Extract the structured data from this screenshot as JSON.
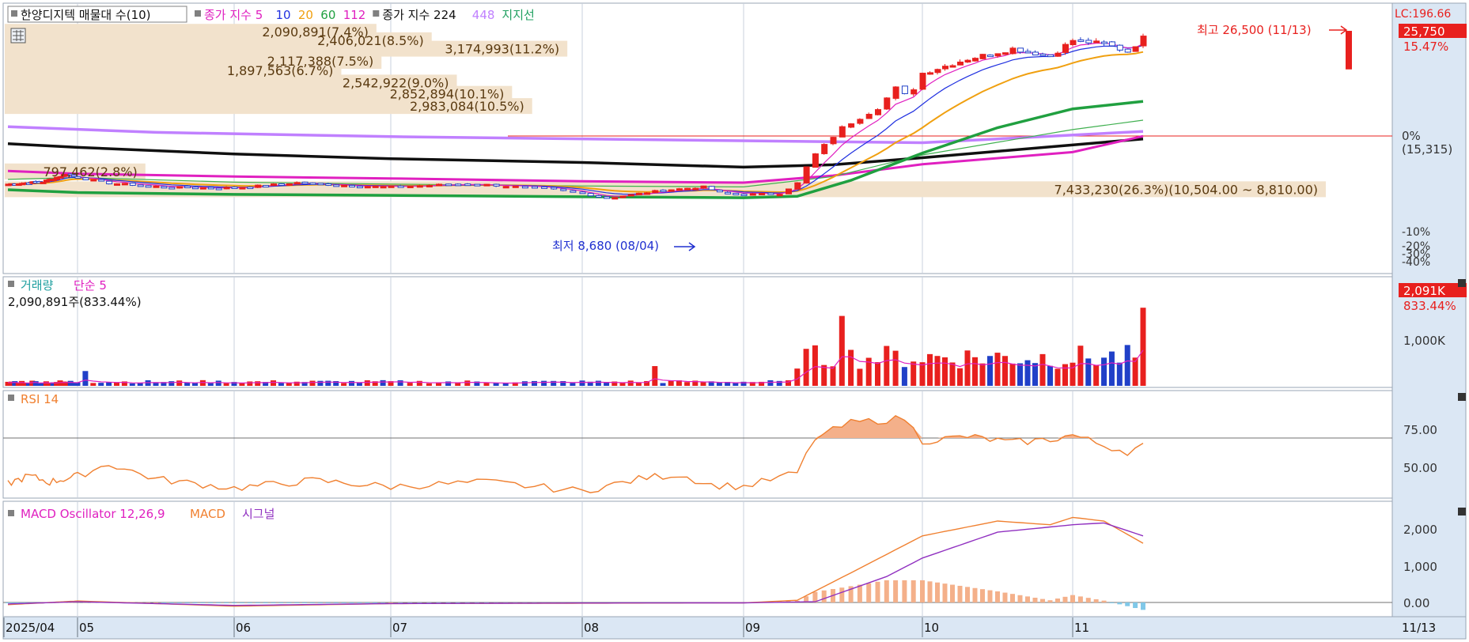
{
  "colors": {
    "up": "#e8201e",
    "down": "#2040c8",
    "ma5": "#e020c0",
    "ma10": "#2030e0",
    "ma20": "#f0a010",
    "ma60": "#20a040",
    "ma112": "#40a060",
    "ma224": "#101010",
    "ma448": "#c080ff",
    "support": "#20a060",
    "rsi": "#f08030",
    "rsi_fill": "#f4b08a",
    "macd_osc": "#e020c0",
    "macd": "#f08030",
    "signal": "#9030c0",
    "histo_pos": "#f4b08a",
    "histo_neg": "#80c8e8",
    "volume_profile": "#f2e2cc",
    "grid": "#c8d0dc",
    "axis_bg": "#dbe7f4"
  },
  "price_panel": {
    "title": "한양디지텍 매물대 수(10)",
    "legend": [
      {
        "label": "종가 지수 5",
        "color": "#e020c0"
      },
      {
        "label": "10",
        "color": "#2030e0"
      },
      {
        "label": "20",
        "color": "#f0a010"
      },
      {
        "label": "60",
        "color": "#20a040"
      },
      {
        "label": "112",
        "color": "#e020c0"
      },
      {
        "label": "종가 지수 224",
        "color": "#101010"
      },
      {
        "label": "448",
        "color": "#c080ff"
      },
      {
        "label": "지지선",
        "color": "#20a060"
      }
    ],
    "high_annotation": "최고 26,500 (11/13)",
    "low_annotation": "최저 8,680 (08/04)",
    "lc_label": "LC:196.66",
    "current_price_label": "25,750",
    "change_label": "15.47%",
    "pct_label": "0%",
    "pct_value_label": "(15,315)",
    "right_ticks": [
      "-10%",
      "-20%",
      "-30%",
      "-40%"
    ],
    "volume_profile": [
      {
        "label": "2,090,891(7.4%)",
        "price": 26400,
        "share": 7.4
      },
      {
        "label": "2,406,021(8.5%)",
        "price": 25500,
        "share": 8.5
      },
      {
        "label": "3,174,993(11.2%)",
        "price": 24600,
        "share": 11.2
      },
      {
        "label": "2,117,388(7.5%)",
        "price": 23300,
        "share": 7.5
      },
      {
        "label": "1,897,563(6.7%)",
        "price": 22300,
        "share": 6.7
      },
      {
        "label": "2,542,922(9.0%)",
        "price": 21000,
        "share": 9.0
      },
      {
        "label": "2,852,894(10.1%)",
        "price": 19800,
        "share": 10.1
      },
      {
        "label": "2,983,084(10.5%)",
        "price": 18500,
        "share": 10.5
      },
      {
        "label": "797,462(2.8%)",
        "price": 11550,
        "share": 2.8
      },
      {
        "label": "7,433,230(26.3%)(10,504.00 ~ 8,810.00)",
        "price": 9650,
        "share": 26.3
      }
    ]
  },
  "volume_panel": {
    "title": "거래량",
    "ma_label": "단순 5",
    "summary": "2,090,891주(833.44%)",
    "last_label": "2,091K",
    "last_pct": "833.44%",
    "ticks": [
      "1,000K"
    ]
  },
  "rsi_panel": {
    "title": "RSI 14",
    "ticks": [
      "75.00",
      "50.00"
    ]
  },
  "macd_panel": {
    "title_osc": "MACD Oscillator 12,26,9",
    "title_macd": "MACD",
    "title_signal": "시그널",
    "ticks": [
      "2,000",
      "1,000",
      "0.00"
    ]
  },
  "x_axis": {
    "labels": [
      "2025/04",
      "05",
      "06",
      "07",
      "08",
      "09",
      "10",
      "11"
    ],
    "right_label": "11/13"
  },
  "chart_data": [
    {
      "type": "candlestick",
      "title": "한양디지텍",
      "x_range": [
        "2025/04",
        "11/13"
      ],
      "y_range": [
        8000,
        27000
      ],
      "key_points": [
        {
          "date": "2025/04",
          "close": 10200
        },
        {
          "date": "05",
          "close": 10900
        },
        {
          "date": "06",
          "close": 9800
        },
        {
          "date": "07",
          "close": 9900
        },
        {
          "date": "08/04",
          "close": 8680
        },
        {
          "date": "09",
          "close": 9100
        },
        {
          "date": "10",
          "close": 22000
        },
        {
          "date": "11",
          "close": 25500
        },
        {
          "date": "11/13",
          "close": 25750,
          "high": 26500
        }
      ],
      "moving_averages": [
        "5",
        "10",
        "20",
        "60",
        "112",
        "224",
        "448"
      ],
      "volume_profile_bins": 10
    },
    {
      "type": "bar",
      "title": "거래량",
      "y_ticks": [
        1000000
      ],
      "last_value": 2090891,
      "notes": "volume spikes in mid-September and at 11/13"
    },
    {
      "type": "line",
      "title": "RSI 14",
      "y_ticks": [
        50,
        75
      ],
      "key_points": [
        {
          "x": "2025/04",
          "y": 45
        },
        {
          "x": "05",
          "y": 53
        },
        {
          "x": "06",
          "y": 42
        },
        {
          "x": "07",
          "y": 43
        },
        {
          "x": "08",
          "y": 40
        },
        {
          "x": "09",
          "y": 44
        },
        {
          "x": "09 mid",
          "y": 88
        },
        {
          "x": "10",
          "y": 78
        },
        {
          "x": "11",
          "y": 70
        },
        {
          "x": "11/13",
          "y": 70
        }
      ]
    },
    {
      "type": "line",
      "title": "MACD Oscillator 12,26,9",
      "y_ticks": [
        0,
        1000,
        2000
      ],
      "series": [
        {
          "name": "MACD",
          "points": [
            0,
            0,
            0,
            0,
            0,
            0,
            2100,
            2300,
            1600
          ]
        },
        {
          "name": "시그널",
          "points": [
            0,
            0,
            0,
            0,
            0,
            0,
            1700,
            2200,
            1800
          ]
        }
      ]
    }
  ]
}
